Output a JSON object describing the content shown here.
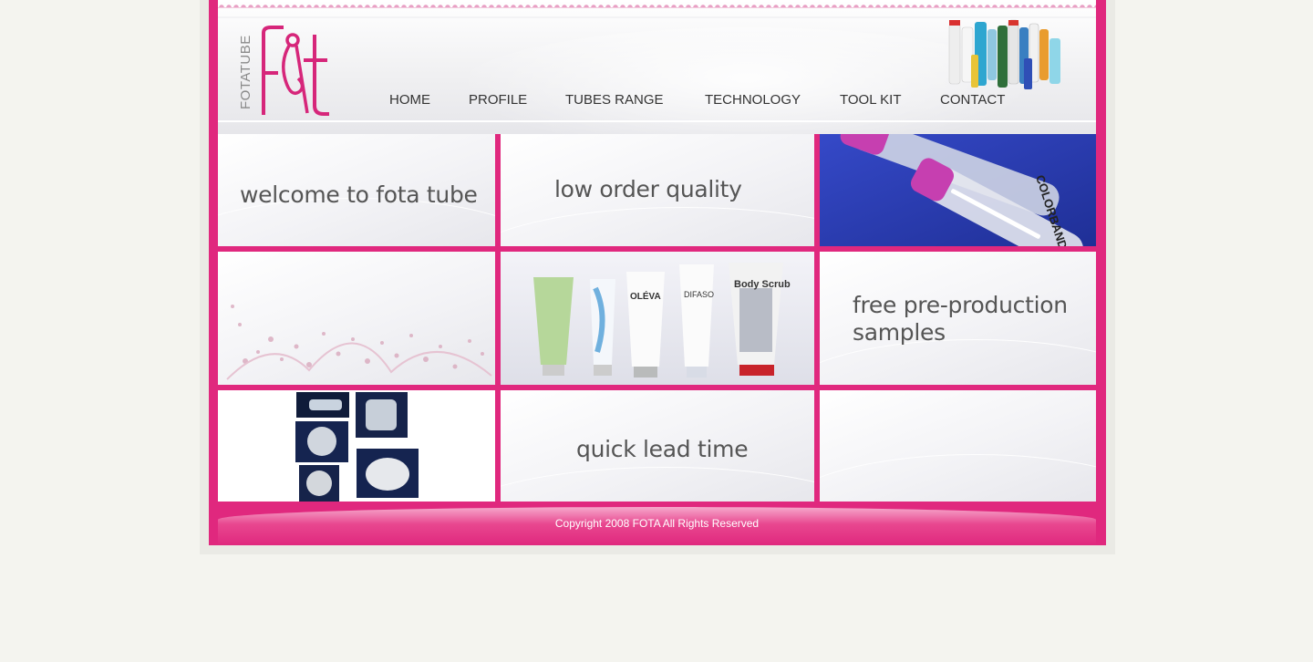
{
  "logo": {
    "vertical_text": "FOTATUBE",
    "mark": "F&T"
  },
  "nav": {
    "items": [
      {
        "label": "HOME"
      },
      {
        "label": "PROFILE"
      },
      {
        "label": "TUBES RANGE"
      },
      {
        "label": "TECHNOLOGY"
      },
      {
        "label": "TOOL KIT"
      },
      {
        "label": "CONTACT"
      }
    ]
  },
  "tiles": {
    "welcome": "welcome to fota tube",
    "low_order": "low order quality",
    "samples_line1": "free pre-production",
    "samples_line2": "samples",
    "lead_time": "quick lead time",
    "lipgloss_brand": "COLORBAND",
    "product_brands": {
      "b1": "OLÉVA",
      "b2": "DIFASO",
      "b3": "Body Scrub"
    }
  },
  "footer": {
    "copyright": "Copyright 2008 FOTA All Rights Reserved"
  },
  "colors": {
    "frame": "#e0287e",
    "page_bg": "#f4f4ef",
    "text": "#555555"
  }
}
